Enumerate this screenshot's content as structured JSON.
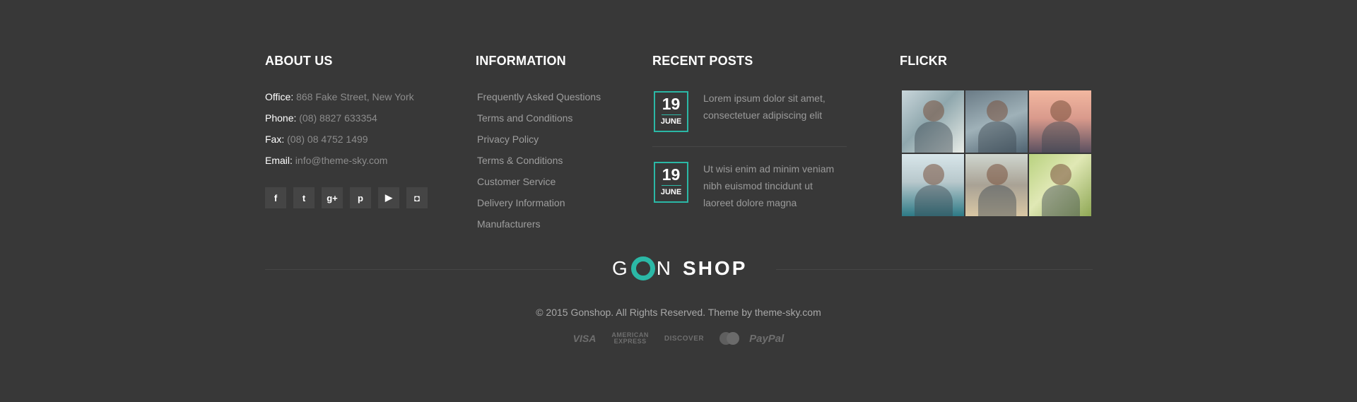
{
  "about": {
    "title": "ABOUT US",
    "office_label": "Office:",
    "office_value": "868 Fake Street, New York",
    "phone_label": "Phone:",
    "phone_value": "(08) 8827 633354",
    "fax_label": "Fax:",
    "fax_value": "(08) 08 4752 1499",
    "email_label": "Email:",
    "email_value": "info@theme-sky.com",
    "social": [
      {
        "icon": "facebook-icon",
        "glyph": "f"
      },
      {
        "icon": "twitter-icon",
        "glyph": "t"
      },
      {
        "icon": "google-plus-icon",
        "glyph": "g+"
      },
      {
        "icon": "pinterest-icon",
        "glyph": "p"
      },
      {
        "icon": "youtube-icon",
        "glyph": "▶"
      },
      {
        "icon": "instagram-icon",
        "glyph": "◘"
      }
    ]
  },
  "information": {
    "title": "INFORMATION",
    "links": [
      "Frequently Asked Questions",
      "Terms and Conditions",
      "Privacy Policy",
      "Terms & Conditions",
      "Customer Service",
      "Delivery Information",
      "Manufacturers"
    ]
  },
  "recent_posts": {
    "title": "RECENT POSTS",
    "posts": [
      {
        "day": "19",
        "month": "JUNE",
        "text": "Lorem ipsum dolor sit amet, consectetuer adipiscing elit"
      },
      {
        "day": "19",
        "month": "JUNE",
        "text": "Ut wisi enim ad minim veniam nibh euismod tincidunt ut laoreet dolore magna"
      }
    ]
  },
  "flickr": {
    "title": "FLICKR",
    "photos": [
      "flickr-photo-1",
      "flickr-photo-2",
      "flickr-photo-3",
      "flickr-photo-4",
      "flickr-photo-5",
      "flickr-photo-6"
    ]
  },
  "logo": {
    "g": "G",
    "n": "N",
    "shop": "SHOP"
  },
  "copyright": "© 2015 Gonshop. All Rights Reserved. Theme by theme-sky.com",
  "payments": {
    "visa": "VISA",
    "amex_1": "AMERICAN",
    "amex_2": "EXPRESS",
    "discover": "DISCOVER",
    "paypal": "PayPal"
  },
  "colors": {
    "background": "#383838",
    "accent": "#2bb8a6"
  }
}
